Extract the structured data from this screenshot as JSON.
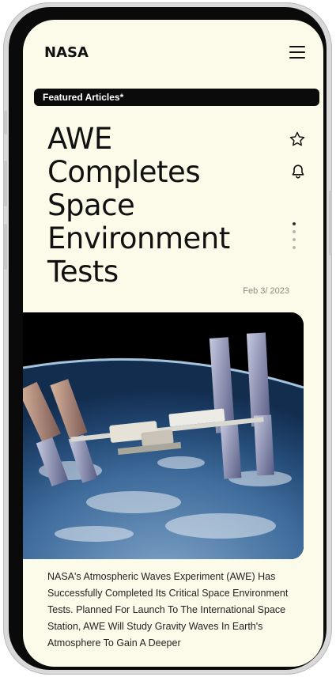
{
  "header": {
    "logo_text": "NASA",
    "menu_icon": "hamburger-menu-icon"
  },
  "featured": {
    "label": "Featured Articles*"
  },
  "article": {
    "title": "AWE Completes Space Environment Tests",
    "date": "Feb 3/ 2023",
    "image_alt": "International Space Station orbiting above Earth",
    "body": "NASA's Atmospheric Waves Experiment (AWE) Has Successfully Completed Its Critical Space Environment Tests. Planned For Launch To The International Space Station, AWE Will Study Gravity Waves In Earth's Atmosphere To Gain A Deeper"
  },
  "actions": {
    "favorite_icon": "star-icon",
    "notify_icon": "bell-icon"
  },
  "pager": {
    "count": 4,
    "active_index": 0
  },
  "colors": {
    "background": "#fcfbe9",
    "text": "#111111",
    "muted": "#8a8a82",
    "badge_bg": "#0b0b0b"
  }
}
